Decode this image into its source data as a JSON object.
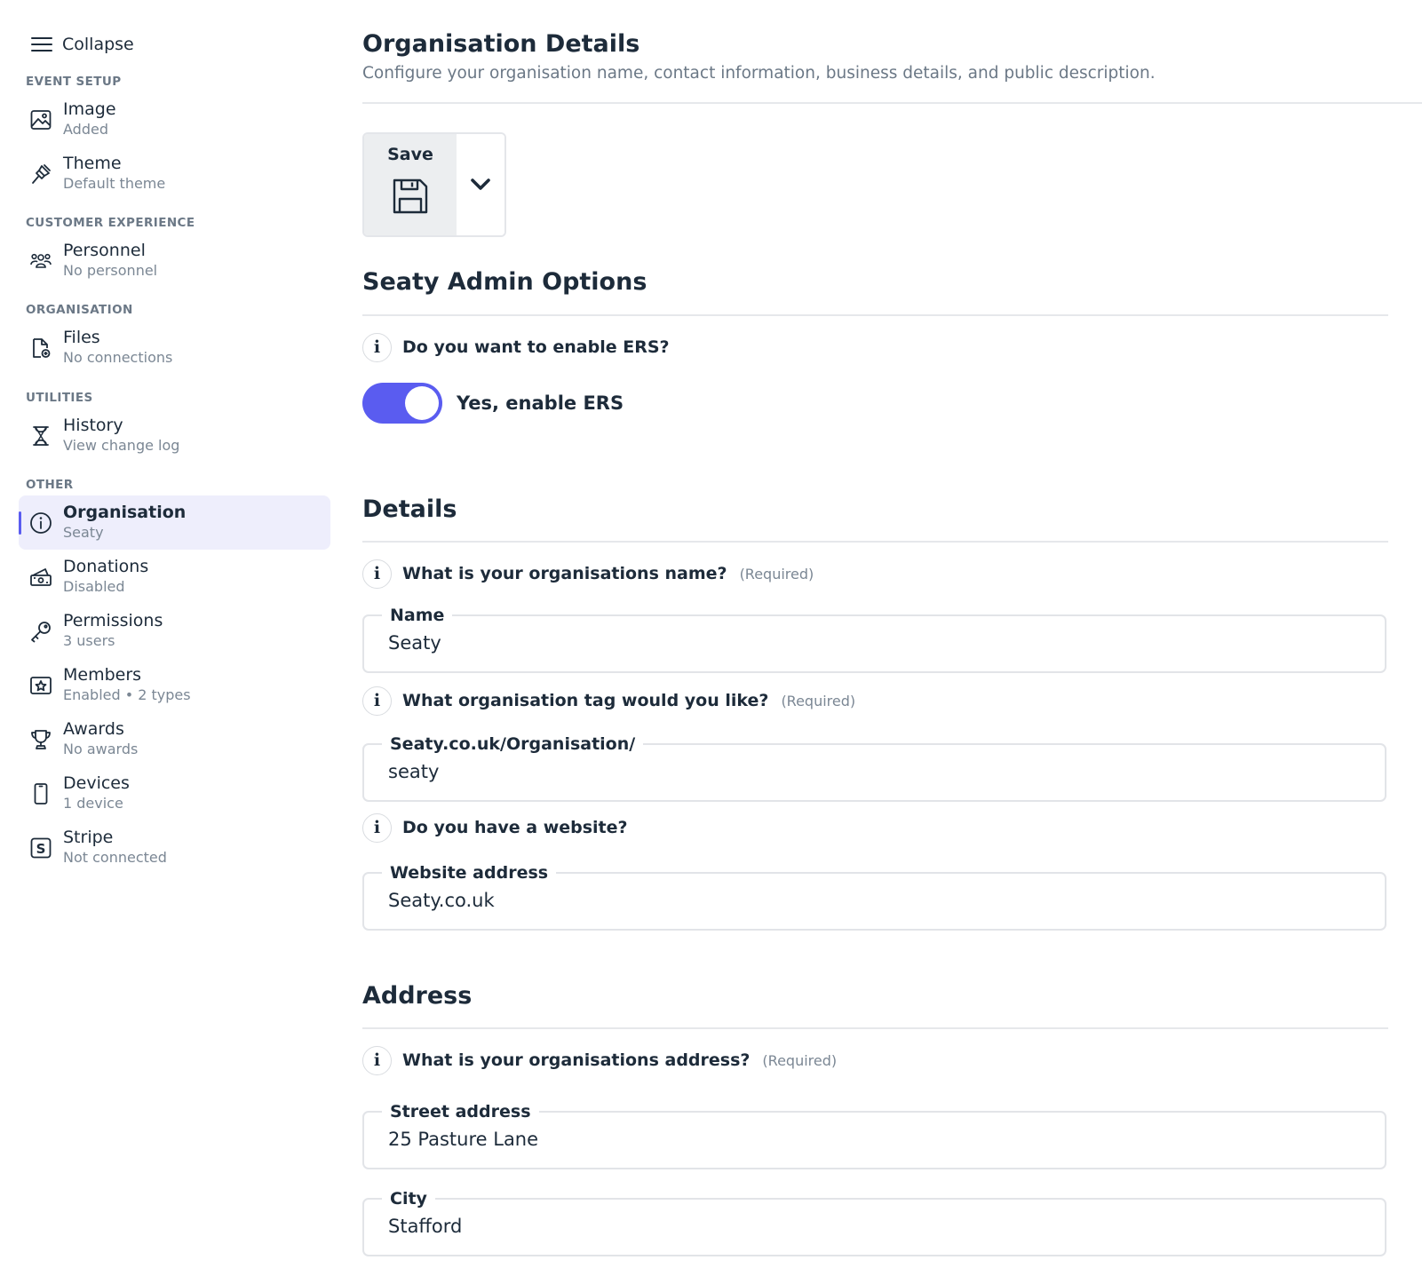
{
  "sidebar": {
    "collapse_label": "Collapse",
    "sections": [
      {
        "title": "EVENT SETUP",
        "items": [
          {
            "label": "Image",
            "sub": "Added",
            "icon": "image-icon"
          },
          {
            "label": "Theme",
            "sub": "Default theme",
            "icon": "brush-icon"
          }
        ]
      },
      {
        "title": "CUSTOMER EXPERIENCE",
        "items": [
          {
            "label": "Personnel",
            "sub": "No personnel",
            "icon": "people-icon"
          }
        ]
      },
      {
        "title": "ORGANISATION",
        "items": [
          {
            "label": "Files",
            "sub": "No connections",
            "icon": "file-icon"
          }
        ]
      },
      {
        "title": "UTILITIES",
        "items": [
          {
            "label": "History",
            "sub": "View change log",
            "icon": "hourglass-icon"
          }
        ]
      },
      {
        "title": "OTHER",
        "items": [
          {
            "label": "Organisation",
            "sub": "Seaty",
            "icon": "info-icon",
            "active": true
          },
          {
            "label": "Donations",
            "sub": "Disabled",
            "icon": "cash-icon"
          },
          {
            "label": "Permissions",
            "sub": "3 users",
            "icon": "key-icon"
          },
          {
            "label": "Members",
            "sub": "Enabled • 2 types",
            "icon": "star-card-icon"
          },
          {
            "label": "Awards",
            "sub": "No awards",
            "icon": "trophy-icon"
          },
          {
            "label": "Devices",
            "sub": "1 device",
            "icon": "phone-icon"
          },
          {
            "label": "Stripe",
            "sub": "Not connected",
            "icon": "stripe-icon"
          }
        ]
      }
    ]
  },
  "main": {
    "title": "Organisation Details",
    "description": "Configure your organisation name, contact information, business details, and public description.",
    "save": {
      "label": "Save",
      "icon": "floppy-disk-icon",
      "dropdown_icon": "chevron-down-icon"
    },
    "admin_options": {
      "heading": "Seaty Admin Options",
      "question": "Do you want to enable ERS?",
      "toggle_label": "Yes, enable ERS",
      "toggle_on": true
    },
    "details": {
      "heading": "Details",
      "name_question": "What is your organisations name?",
      "name_required": "(Required)",
      "name_legend": "Name",
      "name_value": "Seaty",
      "tag_question": "What organisation tag would you like?",
      "tag_required": "(Required)",
      "tag_legend": "Seaty.co.uk/Organisation/",
      "tag_value": "seaty",
      "website_question": "Do you have a website?",
      "website_legend": "Website address",
      "website_value": "Seaty.co.uk"
    },
    "address": {
      "heading": "Address",
      "question": "What is your organisations address?",
      "required": "(Required)",
      "street_legend": "Street address",
      "street_value": "25 Pasture Lane",
      "city_legend": "City",
      "city_value": "Stafford"
    },
    "info_glyph": "i"
  },
  "colors": {
    "accent": "#5a5cf0",
    "text": "#1d2b3a",
    "muted": "#7b8794",
    "active_bg": "#eeeefc"
  }
}
